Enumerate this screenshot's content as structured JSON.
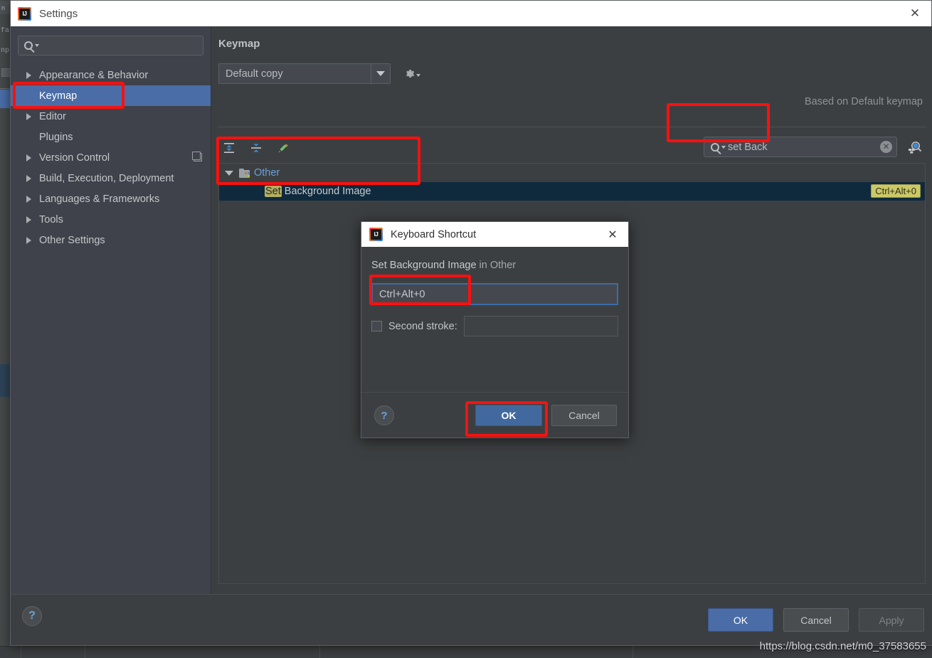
{
  "settings_window": {
    "title": "Settings",
    "logo_icon": "intellij-idea-logo",
    "close_icon": "close-icon",
    "sidebar": {
      "search_placeholder": "",
      "search_icon": "search-icon",
      "items": [
        {
          "label": "Appearance & Behavior",
          "expandable": true,
          "selected": false,
          "badge": false
        },
        {
          "label": "Keymap",
          "expandable": false,
          "selected": true,
          "badge": false
        },
        {
          "label": "Editor",
          "expandable": true,
          "selected": false,
          "badge": false
        },
        {
          "label": "Plugins",
          "expandable": false,
          "selected": false,
          "badge": false
        },
        {
          "label": "Version Control",
          "expandable": true,
          "selected": false,
          "badge": true
        },
        {
          "label": "Build, Execution, Deployment",
          "expandable": true,
          "selected": false,
          "badge": false
        },
        {
          "label": "Languages & Frameworks",
          "expandable": true,
          "selected": false,
          "badge": false
        },
        {
          "label": "Tools",
          "expandable": true,
          "selected": false,
          "badge": false
        },
        {
          "label": "Other Settings",
          "expandable": true,
          "selected": false,
          "badge": false
        }
      ]
    },
    "main": {
      "header": "Keymap",
      "keymap_select_value": "Default copy",
      "gear_icon": "gear-icon",
      "based_on": "Based on Default keymap",
      "toolbar": [
        {
          "icon": "expand-all-icon",
          "name": "expand-all-button"
        },
        {
          "icon": "collapse-all-icon",
          "name": "collapse-all-button"
        },
        {
          "icon": "edit-pencil-icon",
          "name": "edit-shortcut-button"
        }
      ],
      "search": {
        "value": "set Back",
        "search_icon": "search-icon",
        "clear_icon": "clear-icon",
        "find_by_shortcut_icon": "find-by-shortcut-icon"
      },
      "action_tree": {
        "group": {
          "label": "Other",
          "expanded": true,
          "folder_icon": "folder-icon"
        },
        "rows": [
          {
            "label": "Set Background Image",
            "highlight_prefix": "Set",
            "rest": " Background Image",
            "shortcut": "Ctrl+Alt+0",
            "selected": true
          }
        ]
      }
    },
    "footer": {
      "help_icon": "help-icon",
      "ok_label": "OK",
      "cancel_label": "Cancel",
      "apply_label": "Apply"
    }
  },
  "shortcut_dialog": {
    "title": "Keyboard Shortcut",
    "logo_icon": "intellij-idea-logo",
    "close_icon": "close-icon",
    "caption_action": "Set Background Image",
    "caption_suffix": " in Other",
    "first_stroke_value": "Ctrl+Alt+0",
    "second_stroke_label": "Second stroke:",
    "second_stroke_value": "",
    "second_stroke_checked": false,
    "help_icon": "help-icon",
    "ok_label": "OK",
    "cancel_label": "Cancel"
  },
  "annotations": {
    "color": "#fb1010",
    "boxes": [
      {
        "name": "keymap-sidebar-highlight"
      },
      {
        "name": "search-field-highlight"
      },
      {
        "name": "action-tree-highlight"
      },
      {
        "name": "first-stroke-highlight"
      },
      {
        "name": "dialog-ok-highlight"
      }
    ]
  },
  "watermark": {
    "text": "https://blog.csdn.net/m0_37583655"
  },
  "background_ide": {
    "tab_text": "n",
    "line1": "fa",
    "line2": "np"
  },
  "colors": {
    "accent_blue": "#4a6da7",
    "selection_row": "#0f2a3d",
    "shortcut_badge": "#cbc867",
    "panel_bg": "#3c3f41",
    "sidebar_bg": "#3f424a",
    "annotation_red": "#fb1010"
  }
}
